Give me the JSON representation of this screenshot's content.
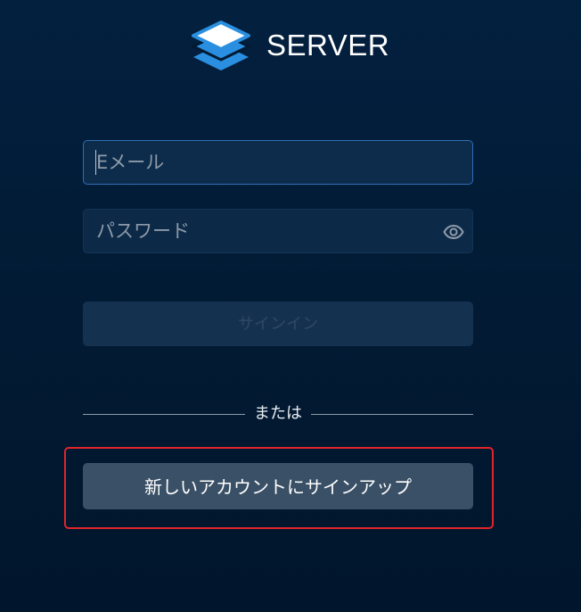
{
  "brand": {
    "name": "SERVER",
    "logo_icon": "stacked-layers-icon",
    "logo_color": "#2a8fe0"
  },
  "login_form": {
    "email": {
      "placeholder": "Eメール",
      "value": ""
    },
    "password": {
      "placeholder": "パスワード",
      "value": "",
      "toggle_icon": "eye-icon"
    },
    "signin_label": "サインイン",
    "signin_disabled": true
  },
  "divider": {
    "label": "または"
  },
  "signup": {
    "label": "新しいアカウントにサインアップ"
  },
  "colors": {
    "background": "#021a33",
    "input_background": "#0c2a48",
    "focus_border": "#2f6db5",
    "signup_button": "#3a5066",
    "highlight_border": "#e0242b"
  }
}
